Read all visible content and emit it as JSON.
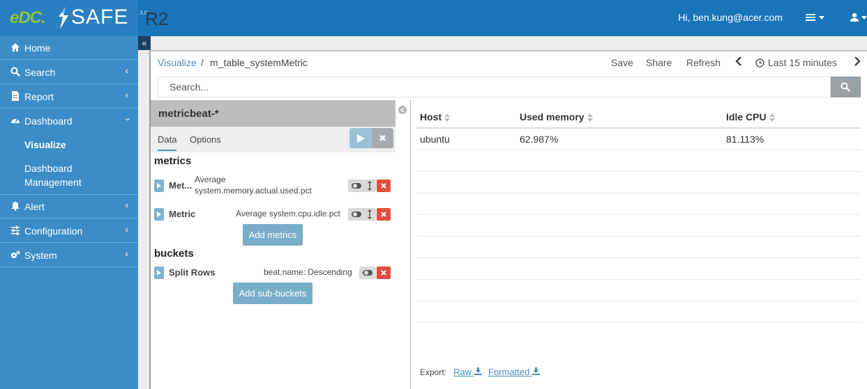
{
  "header": {
    "logo": {
      "edc": "eDC.",
      "safe": "SAFE",
      "version": "3.0",
      "r2": "R2"
    },
    "greeting": "Hi, ben.kung@acer.com",
    "icons": [
      "list-icon",
      "user-icon"
    ]
  },
  "sidebar": {
    "items": [
      {
        "label": "Home",
        "icon": "home-icon"
      },
      {
        "label": "Search",
        "icon": "search-icon"
      },
      {
        "label": "Report",
        "icon": "file-icon"
      },
      {
        "label": "Dashboard",
        "icon": "dashboard-icon"
      },
      {
        "label": "Alert",
        "icon": "bell-icon"
      },
      {
        "label": "Configuration",
        "icon": "sliders-icon"
      },
      {
        "label": "System",
        "icon": "gears-icon"
      }
    ],
    "dashboard_sub": [
      {
        "label": "Visualize"
      },
      {
        "label": "Dashboard"
      },
      {
        "label": "Management"
      }
    ],
    "accent": "#3c8dc7"
  },
  "breadcrumb": {
    "link": "Visualize",
    "separator": "/",
    "current": "m_table_systemMetric"
  },
  "toolbar": {
    "save": "Save",
    "share": "Share",
    "refresh": "Refresh",
    "time": "Last 15 minutes"
  },
  "search": {
    "placeholder": "Search..."
  },
  "editor": {
    "index": "metricbeat-*",
    "tabs": [
      "Data",
      "Options"
    ],
    "metrics_title": "metrics",
    "metrics": [
      {
        "name": "Met...",
        "desc1": "Average",
        "desc2": "system.memory.actual.used.pct"
      },
      {
        "name": "Metric",
        "desc1": "Average system.cpu.idle.pct"
      }
    ],
    "add_metrics": "Add metrics",
    "buckets_title": "buckets",
    "buckets": [
      {
        "name": "Split Rows",
        "desc": "beat.name: Descending"
      }
    ],
    "add_buckets": "Add sub-buckets"
  },
  "table": {
    "columns": [
      "Host",
      "Used memory",
      "Idle CPU"
    ],
    "rows": [
      [
        "ubuntu",
        "62.987%",
        "81.113%"
      ]
    ]
  },
  "export": {
    "label": "Export:",
    "raw": "Raw",
    "formatted": "Formatted"
  }
}
